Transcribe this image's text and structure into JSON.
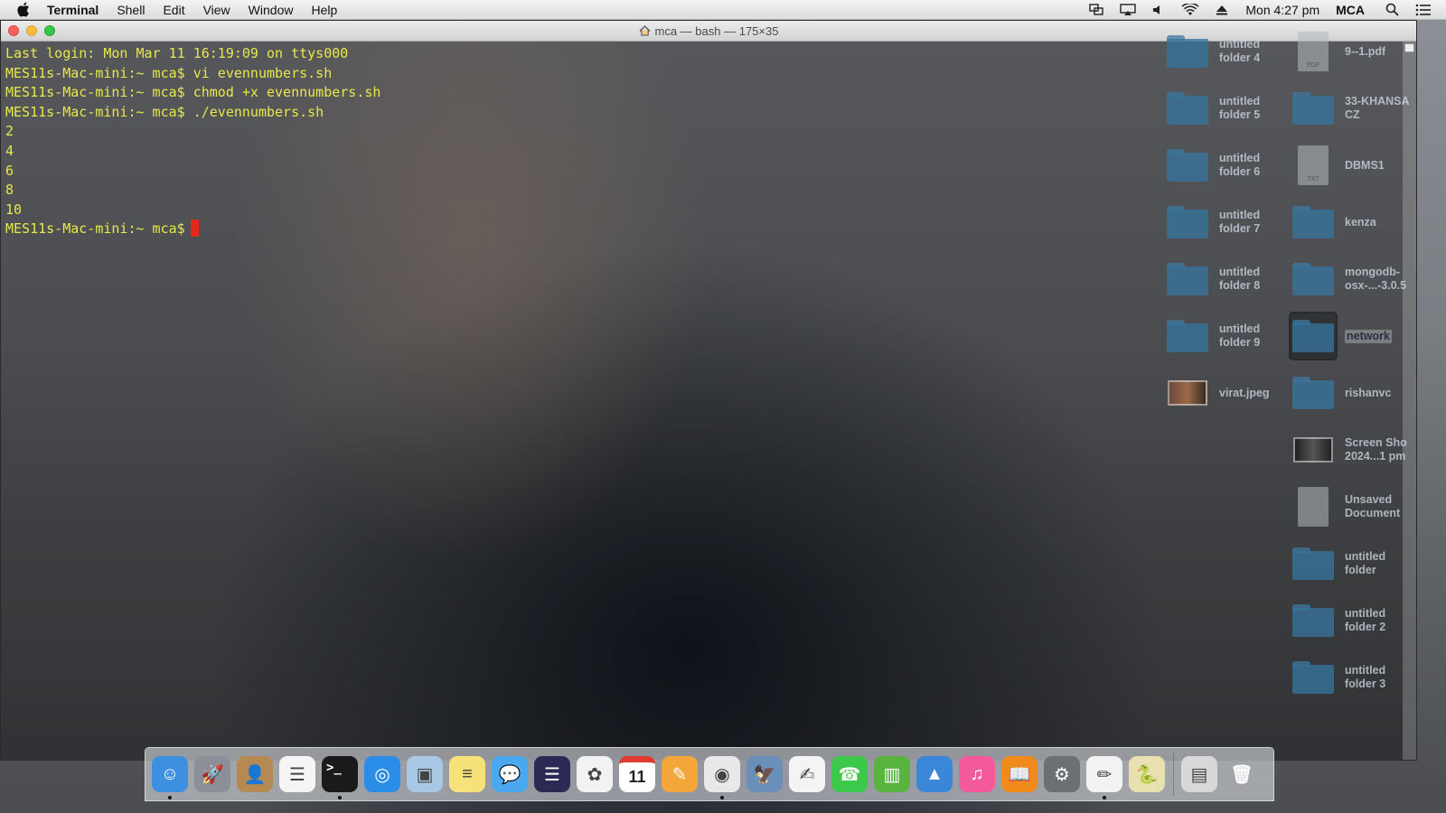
{
  "menubar": {
    "app_name": "Terminal",
    "menus": [
      "Shell",
      "Edit",
      "View",
      "Window",
      "Help"
    ],
    "clock": "Mon 4:27 pm",
    "user": "MCA",
    "status_icons": [
      "window-mirroring-icon",
      "airplay-icon",
      "volume-icon",
      "wifi-icon",
      "eject-icon"
    ]
  },
  "terminal": {
    "title": "mca — bash — 175×35",
    "lines": [
      "Last login: Mon Mar 11 16:19:09 on ttys000",
      "MES11s-Mac-mini:~ mca$ vi evennumbers.sh",
      "MES11s-Mac-mini:~ mca$ chmod +x evennumbers.sh",
      "MES11s-Mac-mini:~ mca$ ./evennumbers.sh",
      "2",
      "4",
      "6",
      "8",
      "10"
    ],
    "prompt": "MES11s-Mac-mini:~ mca$ "
  },
  "desktop": {
    "left_column": [
      {
        "label": "untitled\nfolder 4",
        "kind": "folder"
      },
      {
        "label": "untitled\nfolder 5",
        "kind": "folder"
      },
      {
        "label": "untitled\nfolder 6",
        "kind": "folder"
      },
      {
        "label": "untitled\nfolder 7",
        "kind": "folder"
      },
      {
        "label": "untitled\nfolder 8",
        "kind": "folder"
      },
      {
        "label": "untitled\nfolder 9",
        "kind": "folder"
      },
      {
        "label": "virat.jpeg",
        "kind": "image"
      }
    ],
    "right_column": [
      {
        "label": "9--1.pdf",
        "kind": "pdf",
        "badge": "PDF"
      },
      {
        "label": "33-KHANSA\nCZ",
        "kind": "folder"
      },
      {
        "label": "DBMS1",
        "kind": "txt",
        "badge": "TXT"
      },
      {
        "label": "kenza",
        "kind": "folder"
      },
      {
        "label": "mongodb-\nosx-...-3.0.5",
        "kind": "folder"
      },
      {
        "label": "network",
        "kind": "folder",
        "selected": true
      },
      {
        "label": "rishanvc",
        "kind": "folder"
      },
      {
        "label": "Screen Sho\n2024...1 pm",
        "kind": "screenshot"
      },
      {
        "label": "Unsaved\nDocument",
        "kind": "doc"
      },
      {
        "label": "untitled\nfolder",
        "kind": "folder"
      },
      {
        "label": "untitled\nfolder 2",
        "kind": "folder"
      },
      {
        "label": "untitled\nfolder 3",
        "kind": "folder"
      }
    ]
  },
  "dock": {
    "apps": [
      {
        "name": "finder-icon",
        "bg": "#3d8fe0",
        "glyph": "☺",
        "running": true
      },
      {
        "name": "launchpad-icon",
        "bg": "#8a8f98",
        "glyph": "🚀"
      },
      {
        "name": "contacts-icon",
        "bg": "#b58a52",
        "glyph": "👤"
      },
      {
        "name": "reminders-icon",
        "bg": "#f5f5f5",
        "glyph": "☰"
      },
      {
        "name": "terminal-icon",
        "bg": "#1a1a1a",
        "glyph": ">_",
        "running": true
      },
      {
        "name": "safari-icon",
        "bg": "#2a8de8",
        "glyph": "◎"
      },
      {
        "name": "preview-icon",
        "bg": "#a9c8e6",
        "glyph": "▣"
      },
      {
        "name": "notes-icon",
        "bg": "#f7e27a",
        "glyph": "≡"
      },
      {
        "name": "messages-icon",
        "bg": "#4aa8f0",
        "glyph": "💬"
      },
      {
        "name": "eclipse-icon",
        "bg": "#2c2955",
        "glyph": "☰"
      },
      {
        "name": "photos-icon",
        "bg": "#f2f2f2",
        "glyph": "✿"
      },
      {
        "name": "calendar-icon",
        "bg": "#ffffff",
        "glyph": "11"
      },
      {
        "name": "pages-icon",
        "bg": "#f3a63a",
        "glyph": "✎"
      },
      {
        "name": "chrome-icon",
        "bg": "#e8e8e8",
        "glyph": "◉",
        "running": true
      },
      {
        "name": "photo-editor-icon",
        "bg": "#6a8fb8",
        "glyph": "🦅"
      },
      {
        "name": "textedit-icon",
        "bg": "#f4f4f4",
        "glyph": "✍"
      },
      {
        "name": "facetime-icon",
        "bg": "#3cc84a",
        "glyph": "☎"
      },
      {
        "name": "numbers-icon",
        "bg": "#58b33f",
        "glyph": "▥"
      },
      {
        "name": "keynote-icon",
        "bg": "#3a86d8",
        "glyph": "▲"
      },
      {
        "name": "itunes-icon",
        "bg": "#f25a9b",
        "glyph": "♫"
      },
      {
        "name": "ibooks-icon",
        "bg": "#f08a1a",
        "glyph": "📖"
      },
      {
        "name": "system-preferences-icon",
        "bg": "#6c6f74",
        "glyph": "⚙"
      },
      {
        "name": "textedit-pen-icon",
        "bg": "#f2f2f2",
        "glyph": "✏",
        "running": true
      },
      {
        "name": "python-launcher-icon",
        "bg": "#e8e0b0",
        "glyph": "🐍"
      }
    ],
    "trailing": [
      {
        "name": "downloads-stack-icon",
        "bg": "#d8d8d8",
        "glyph": "▤"
      },
      {
        "name": "trash-icon",
        "bg": "transparent",
        "glyph": "🗑"
      }
    ]
  },
  "colors": {
    "terminal_text": "#e7e84a",
    "cursor": "#e6281c"
  }
}
